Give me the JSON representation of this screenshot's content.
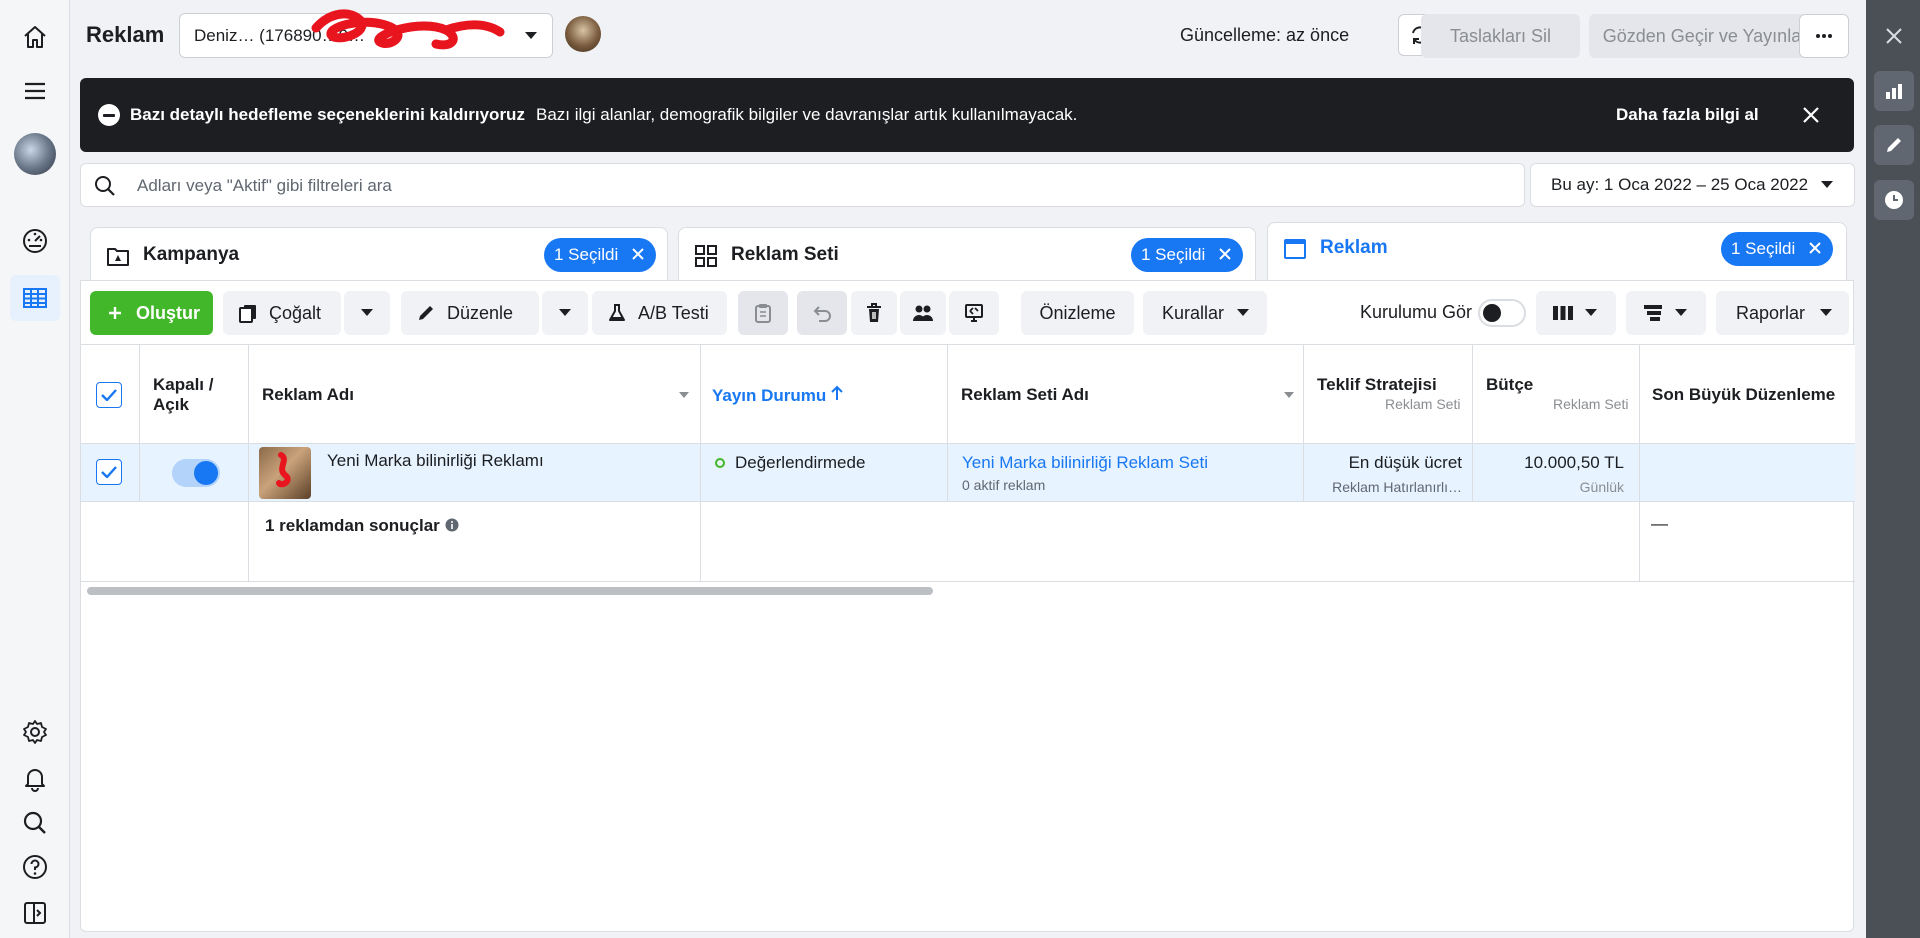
{
  "header": {
    "title": "Reklam",
    "account": "Deniz… (176890…0…",
    "update_status": "Güncelleme: az önce",
    "delete_drafts": "Taslakları Sil",
    "review_publish": "Gözden Geçir ve Yayınla"
  },
  "banner": {
    "title": "Bazı detaylı hedefleme seçeneklerini kaldırıyoruz",
    "text": "Bazı ilgi alanlar, demografik bilgiler ve davranışlar artık kullanılmayacak.",
    "link": "Daha fazla bilgi al"
  },
  "search": {
    "placeholder": "Adları veya \"Aktif\" gibi filtreleri ara"
  },
  "date_range": "Bu ay: 1 Oca 2022 – 25 Oca 2022",
  "tabs": [
    {
      "label": "Kampanya",
      "chip": "1 Seçildi"
    },
    {
      "label": "Reklam Seti",
      "chip": "1 Seçildi"
    },
    {
      "label": "Reklam",
      "chip": "1 Seçildi"
    }
  ],
  "toolbar": {
    "create": "Oluştur",
    "duplicate": "Çoğalt",
    "edit": "Düzenle",
    "ab_test": "A/B Testi",
    "preview": "Önizleme",
    "rules": "Kurallar",
    "view_setup": "Kurulumu Gör",
    "reports": "Raporlar"
  },
  "table": {
    "headers": {
      "toggle": "Kapalı / Açık",
      "ad_name": "Reklam Adı",
      "delivery": "Yayın Durumu",
      "adset_name": "Reklam Seti Adı",
      "bid_strategy": "Teklif Stratejisi",
      "bid_strategy_sub": "Reklam Seti",
      "budget": "Bütçe",
      "budget_sub": "Reklam Seti",
      "last_edit": "Son Büyük Düzenleme"
    },
    "row": {
      "ad_name": "Yeni Marka bilinirliği Reklamı",
      "delivery": "Değerlendirmede",
      "adset_name": "Yeni Marka bilinirliği Reklam Seti",
      "adset_sub": "0 aktif reklam",
      "bid": "En düşük ücret",
      "bid_sub": "Reklam Hatırlanırlı…",
      "budget": "10.000,50 TL",
      "budget_sub": "Günlük"
    },
    "summary": {
      "label": "1 reklamdan sonuçlar",
      "last_edit": "—"
    }
  },
  "colors": {
    "accent": "#1877f2",
    "create_green": "#42b72a",
    "banner_bg": "#1c1e21",
    "selected_row": "#e7f3ff",
    "status_green": "#42b72a"
  }
}
